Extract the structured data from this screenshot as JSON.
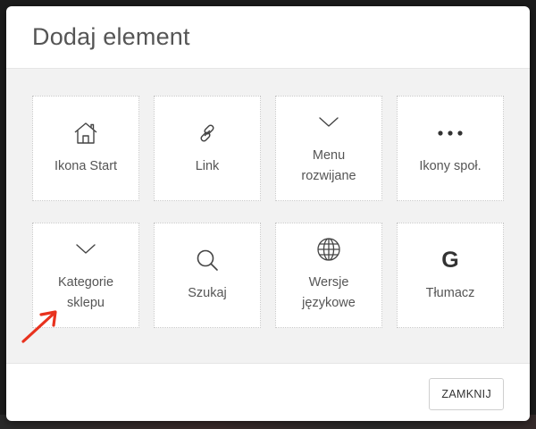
{
  "dialog": {
    "title": "Dodaj element",
    "close_label": "ZAMKNIJ"
  },
  "tiles": [
    {
      "icon": "home-icon",
      "label": "Ikona Start"
    },
    {
      "icon": "link-icon",
      "label": "Link"
    },
    {
      "icon": "chevron-down-icon",
      "label": "Menu\nrozwijane"
    },
    {
      "icon": "more-horizontal-icon",
      "label": "Ikony społ."
    },
    {
      "icon": "chevron-down-icon",
      "label": "Kategorie\nsklepu"
    },
    {
      "icon": "search-icon",
      "label": "Szukaj"
    },
    {
      "icon": "globe-icon",
      "label": "Wersje\njęzykowe"
    },
    {
      "icon": "google-icon",
      "label": "Tłumacz",
      "glyph": "G"
    }
  ],
  "colors": {
    "annotation_arrow": "#e8321e",
    "body_background": "#f2f2f2",
    "tile_background": "#ffffff",
    "text": "#555555"
  }
}
